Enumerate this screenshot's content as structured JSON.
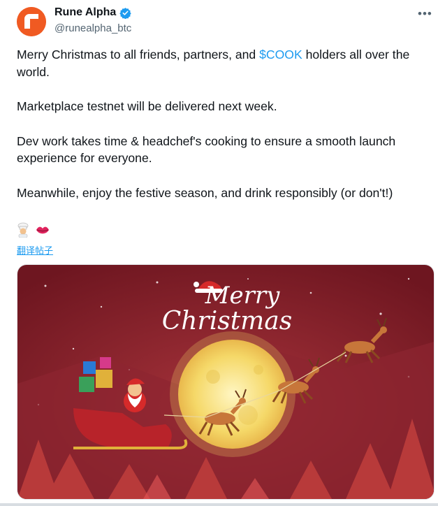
{
  "author": {
    "display_name": "Rune Alpha",
    "handle": "@runealpha_btc",
    "verified": true,
    "avatar_color": "#f05a22"
  },
  "post": {
    "line1_before": "Merry Christmas to all friends, partners, and ",
    "cashtag": "$COOK",
    "line1_after": " holders all over the world.",
    "p2": "Marketplace testnet will be delivered next week.",
    "p3": "Dev work takes time & headchef's cooking  to ensure a smooth launch experience for everyone.",
    "p4": "Meanwhile, enjoy the festive season, and drink responsibly (or don't!)",
    "emojis": [
      "chef-emoji",
      "kiss-mark-emoji"
    ],
    "translate_link": "翻译帖子"
  },
  "media": {
    "greeting_line1": "Merry",
    "greeting_line2": "Christmas",
    "colors": {
      "background": "#8a1f26",
      "moon": "#f8e07a",
      "tree": "#b83a3a"
    }
  },
  "accent_color": "#1d9bf0"
}
